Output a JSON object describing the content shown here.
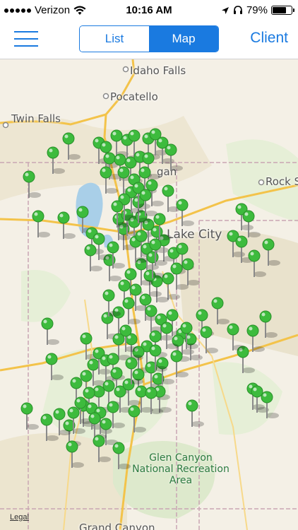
{
  "status_bar": {
    "carrier": "Verizon",
    "time": "10:16 AM",
    "battery": "79%",
    "battery_level": 0.79,
    "icons": [
      "signal-dots-icon",
      "wifi-icon",
      "location-arrow-icon",
      "headphones-icon",
      "battery-icon"
    ]
  },
  "nav": {
    "menu_icon": "hamburger-menu-icon",
    "segments": [
      {
        "label": "List",
        "selected": false
      },
      {
        "label": "Map",
        "selected": true
      }
    ],
    "right_button": "Client",
    "accent_color": "#1a7ae0"
  },
  "map": {
    "places": {
      "idaho_falls": "Idaho Falls",
      "pocatello": "Pocatello",
      "twin_falls": "Twin Falls",
      "ogden": "gan",
      "salt_lake": "Lake City",
      "rock_springs": "Rock S",
      "park_name": "Glen Canyon National Recreation Area",
      "grand_canyon": "Grand Canyon"
    },
    "legal": "Legal",
    "pin_color": "#3dbb3d",
    "pin_icon": "map-pin-icon"
  }
}
